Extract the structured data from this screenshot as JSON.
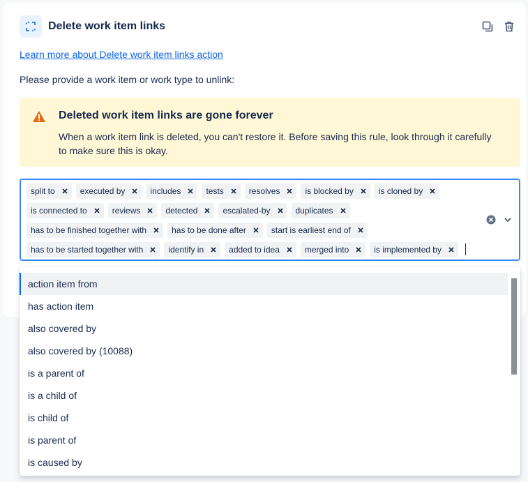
{
  "action": {
    "title": "Delete work item links",
    "learn_more": "Learn more about Delete work item links action",
    "prompt": "Please provide a work item or work type to unlink:"
  },
  "warning": {
    "title": "Deleted work item links are gone forever",
    "body": "When a work item link is deleted, you can't restore it. Before saving this rule, look through it carefully to make sure this is okay."
  },
  "selected_links": [
    "split to",
    "executed by",
    "includes",
    "tests",
    "resolves",
    "is blocked by",
    "is cloned by",
    "is connected to",
    "reviews",
    "detected",
    "escalated-by",
    "duplicates",
    "has to be finished together with",
    "has to be done after",
    "start is earliest end of",
    "has to be started together with",
    "identify in",
    "added to idea",
    "merged into",
    "is implemented by"
  ],
  "options": [
    "action item from",
    "has action item",
    "also covered by",
    "also covered by (10088)",
    "is a parent of",
    "is a child of",
    "is child of",
    "is parent of",
    "is caused by"
  ],
  "active_option_index": 0,
  "colors": {
    "accent": "#0c66e4",
    "focus_border": "#388bff",
    "warning_bg": "#fff7d6",
    "warning_icon": "#e56910"
  },
  "icons": {
    "action": "unlink-icon",
    "duplicate": "duplicate-icon",
    "delete": "trash-icon",
    "warning": "warning-icon",
    "clear": "clear-circle-icon",
    "dropdown": "chevron-down-icon",
    "chip_remove": "close-icon"
  }
}
